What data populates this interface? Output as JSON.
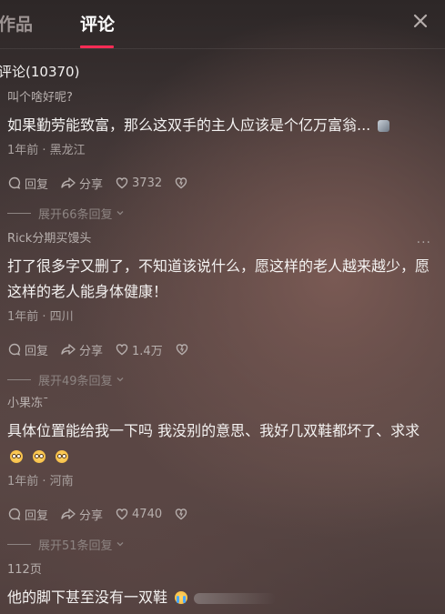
{
  "tabs": {
    "works": "作品",
    "comments": "评论"
  },
  "count_label": "评论(10370)",
  "icons": {
    "close": "close-icon",
    "reply": "reply-bubble-icon",
    "share": "share-arrow-icon",
    "like": "heart-icon",
    "dislike": "broken-heart-icon",
    "chevron": "chevron-down-icon",
    "more": "more-dots-icon"
  },
  "colors": {
    "accent": "#fe2c55"
  },
  "comments": [
    {
      "author": "叫个啥好呢?",
      "text": "如果勤劳能致富，那么这双手的主人应该是个亿万富翁...",
      "meta": "1年前 · 黑龙江",
      "reply": "回复",
      "share": "分享",
      "likes": "3732",
      "expand": "展开66条回复"
    },
    {
      "author": "Rick分期买馒头",
      "more": "···",
      "text": "打了很多字又删了，不知道该说什么，愿这样的老人越来越少，愿这样的老人能身体健康！",
      "meta": "1年前 · 四川",
      "reply": "回复",
      "share": "分享",
      "likes": "1.4万",
      "expand": "展开49条回复"
    },
    {
      "author": "小果冻ˉ",
      "text": "具体位置能给我一下吗 我没别的意思、我好几双鞋都坏了、求求",
      "meta": "1年前 · 河南",
      "reply": "回复",
      "share": "分享",
      "likes": "4740",
      "expand": "展开51条回复"
    },
    {
      "author": "112页",
      "text": "他的脚下甚至没有一双鞋"
    }
  ]
}
